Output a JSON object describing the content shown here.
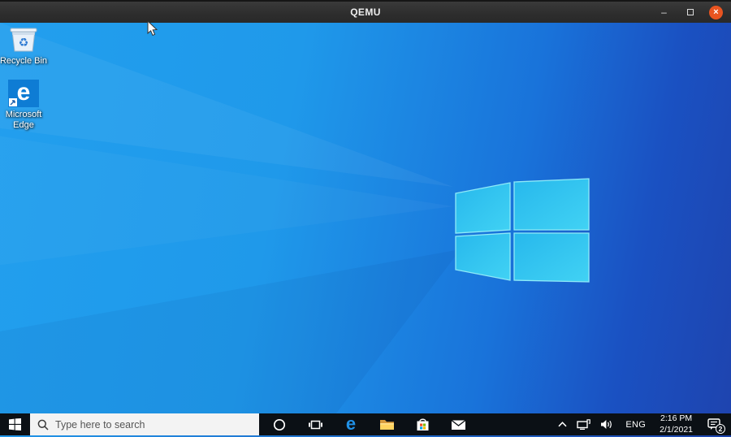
{
  "window": {
    "title": "QEMU",
    "controls": {
      "minimize_glyph": "–",
      "close_glyph": "×"
    }
  },
  "desktop": {
    "icons": [
      {
        "id": "recycle-bin",
        "label": "Recycle Bin"
      },
      {
        "id": "microsoft-edge",
        "label": "Microsoft Edge"
      }
    ],
    "edge_tile_letter": "e"
  },
  "taskbar": {
    "search": {
      "placeholder": "Type here to search"
    },
    "app_icons": [
      {
        "id": "cortana"
      },
      {
        "id": "task-view"
      },
      {
        "id": "edge"
      },
      {
        "id": "file-explorer"
      },
      {
        "id": "store"
      },
      {
        "id": "mail"
      }
    ],
    "edge_letter": "e",
    "tray": {
      "language": "ENG",
      "time": "2:16 PM",
      "date": "2/1/2021",
      "notification_count": "2"
    }
  },
  "colors": {
    "close_button": "#e95420",
    "titlebar": "#2d2d2d",
    "taskbar": "#0b1015",
    "wallpaper_left": "#229fee",
    "wallpaper_right": "#1e44af",
    "logo_cyan": "#2cc4f1",
    "edge_blue": "#0e7cd4",
    "folder_yellow": "#ffd35e",
    "store_red": "#f25022",
    "store_green": "#7fba00",
    "store_blue": "#00a4ef",
    "store_yellow": "#ffb900"
  }
}
